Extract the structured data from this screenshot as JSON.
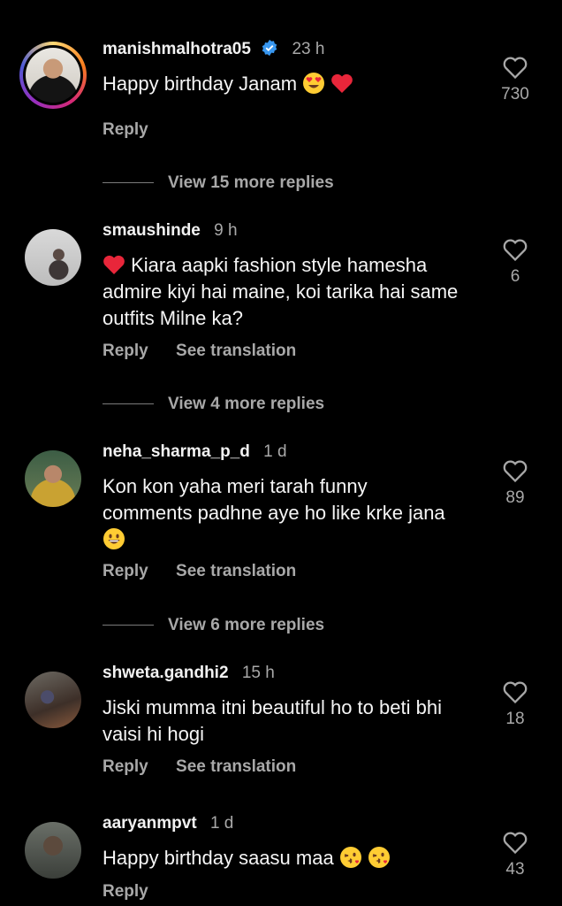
{
  "comments": [
    {
      "username": "manishmalhotra05",
      "verified": true,
      "time": "23 h",
      "text": "Happy birthday Janam",
      "emojis": [
        "heart-eyes-emoji",
        "red-heart-emoji"
      ],
      "likes": "730",
      "reply_label": "Reply",
      "translation_label": "",
      "view_more": "View 15 more replies"
    },
    {
      "username": "smaushinde",
      "time": "9 h",
      "text": "Kiara aapki fashion style hamesha admire kiyi hai maine, koi tarika hai same outfits Milne ka?",
      "emojis": [
        "red-heart-emoji"
      ],
      "likes": "6",
      "reply_label": "Reply",
      "translation_label": "See translation",
      "view_more": "View 4 more replies"
    },
    {
      "username": "neha_sharma_p_d",
      "time": "1 d",
      "text": "Kon kon yaha meri tarah funny comments padhne aye ho like krke jana",
      "emojis": [
        "grinning-face-emoji"
      ],
      "likes": "89",
      "reply_label": "Reply",
      "translation_label": "See translation",
      "view_more": "View 6 more replies"
    },
    {
      "username": "shweta.gandhi2",
      "time": "15 h",
      "text": "Jiski mumma itni beautiful ho to beti bhi vaisi hi hogi",
      "likes": "18",
      "reply_label": "Reply",
      "translation_label": "See translation"
    },
    {
      "username": "aaryanmpvt",
      "time": "1 d",
      "text": "Happy birthday saasu maa",
      "emojis": [
        "kissing-face-emoji",
        "kissing-face-emoji"
      ],
      "likes": "43",
      "reply_label": "Reply",
      "translation_label": ""
    }
  ],
  "colors": {
    "background": "#000000",
    "primary_text": "#f5f5f5",
    "secondary_text": "#a8a8a8",
    "verified_badge": "#3897f0",
    "heart_emoji": "#e8263a"
  }
}
